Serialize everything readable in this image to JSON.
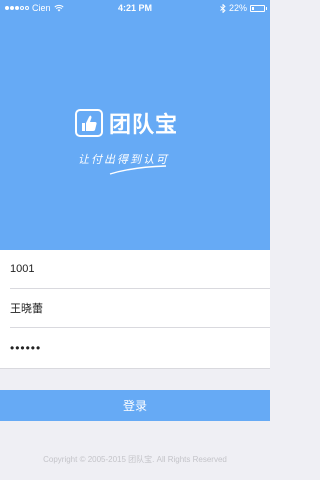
{
  "status_bar": {
    "carrier": "Cien",
    "time": "4:21 PM",
    "battery": "22%",
    "battery_level": 0.22
  },
  "brand": {
    "name": "团队宝",
    "slogan": "让付出得到认可",
    "color": "#66aaf5"
  },
  "login": {
    "account_value": "1001",
    "name_value": "王晓蕾",
    "password_value": "••••••",
    "button_label": "登录"
  },
  "footer": {
    "copyright": "Copyright © 2005-2015 团队宝. All Rights Reserved"
  },
  "icons": [
    "wifi-icon",
    "bluetooth-icon",
    "battery-icon",
    "thumbs-up-logo-icon"
  ]
}
